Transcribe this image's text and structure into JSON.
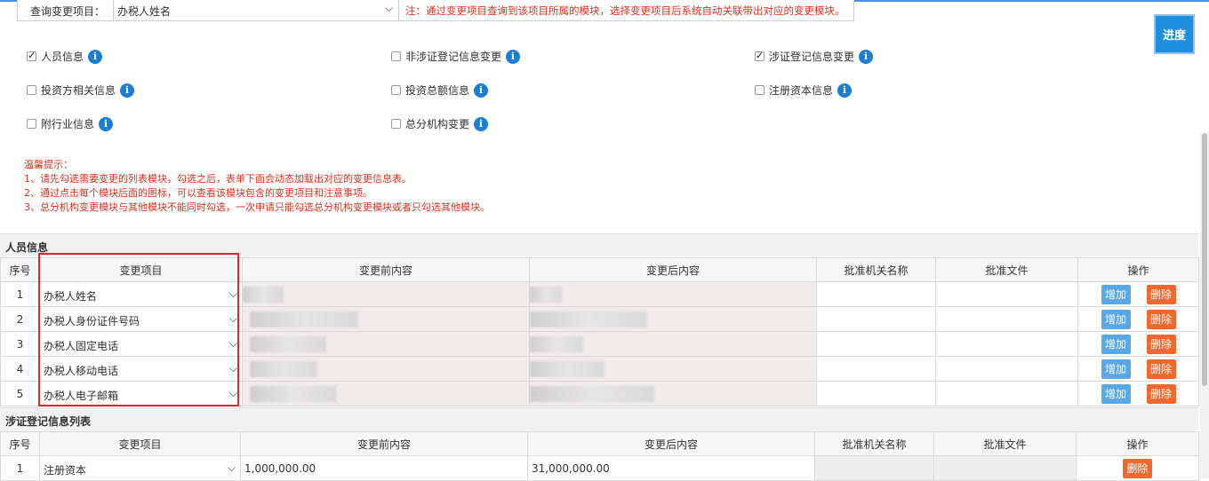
{
  "query": {
    "label": "查询变更项目：",
    "selected": "办税人姓名",
    "note": "注：通过变更项目查询到该项目所属的模块，选择变更项目后系统自动关联带出对应的变更模块。"
  },
  "progress_label": "进度",
  "modules": [
    {
      "label": "人员信息",
      "checked": true
    },
    {
      "label": "非涉证登记信息变更",
      "checked": false
    },
    {
      "label": "涉证登记信息变更",
      "checked": true
    },
    {
      "label": "投资方相关信息",
      "checked": false
    },
    {
      "label": "投资总额信息",
      "checked": false
    },
    {
      "label": "注册资本信息",
      "checked": false
    },
    {
      "label": "附行业信息",
      "checked": false
    },
    {
      "label": "总分机构变更",
      "checked": false
    }
  ],
  "tips": [
    "温馨提示：",
    "1、请先勾选需要变更的列表模块，勾选之后，表单下面会动态加载出对应的变更信息表。",
    "2、通过点击每个模块后面的图标，可以查看该模块包含的变更项目和注意事项。",
    "3、总分机构变更模块与其他模块不能同时勾选，一次申请只能勾选总分机构变更模块或者只勾选其他模块。"
  ],
  "personnel": {
    "title": "人员信息",
    "headers": [
      "序号",
      "变更项目",
      "变更前内容",
      "变更后内容",
      "批准机关名称",
      "批准文件",
      "操作"
    ],
    "rows": [
      {
        "no": "1",
        "item": "办税人姓名"
      },
      {
        "no": "2",
        "item": "办税人身份证件号码"
      },
      {
        "no": "3",
        "item": "办税人固定电话"
      },
      {
        "no": "4",
        "item": "办税人移动电话"
      },
      {
        "no": "5",
        "item": "办税人电子邮箱"
      }
    ],
    "add_label": "增加",
    "delete_label": "删除"
  },
  "registration": {
    "title": "涉证登记信息列表",
    "headers": [
      "序号",
      "变更项目",
      "变更前内容",
      "变更后内容",
      "批准机关名称",
      "批准文件",
      "操作"
    ],
    "rows": [
      {
        "no": "1",
        "item": "注册资本",
        "before": "1,000,000.00",
        "after": "31,000,000.00"
      }
    ],
    "delete_label": "删除"
  },
  "colors": {
    "accent": "#1f8fe0",
    "danger": "#ef6a2c",
    "warning_text": "#e0301e",
    "highlight_box": "#e02828"
  }
}
